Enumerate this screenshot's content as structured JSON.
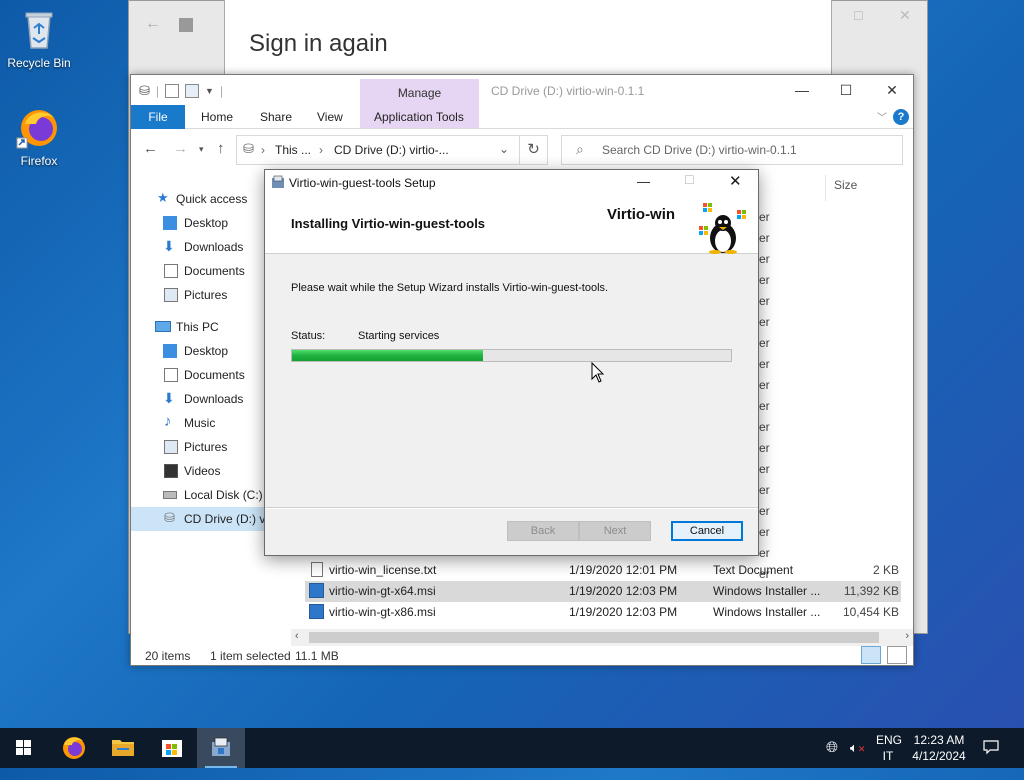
{
  "desktop": {
    "icons": [
      {
        "label": "Recycle Bin"
      },
      {
        "label": "Firefox"
      }
    ]
  },
  "background_window": {
    "title": "Sign in again"
  },
  "explorer": {
    "window_title": "CD Drive (D:) virtio-win-0.1.1",
    "context_tab_group": "Manage",
    "tabs": [
      "File",
      "Home",
      "Share",
      "View",
      "Application Tools"
    ],
    "breadcrumb": [
      "This ...",
      "CD Drive (D:) virtio-..."
    ],
    "search_placeholder": "Search CD Drive (D:) virtio-win-0.1.1",
    "column_size": "Size",
    "nav": {
      "quick_access": "Quick access",
      "quick_items": [
        "Desktop",
        "Downloads",
        "Documents",
        "Pictures"
      ],
      "this_pc": "This PC",
      "pc_items": [
        "Desktop",
        "Documents",
        "Downloads",
        "Music",
        "Pictures",
        "Videos",
        "Local Disk (C:)",
        "CD Drive (D:) vi"
      ]
    },
    "files": [
      {
        "name": "virtio-win_license.txt",
        "date": "1/19/2020 12:01 PM",
        "type": "Text Document",
        "size": "2 KB"
      },
      {
        "name": "virtio-win-gt-x64.msi",
        "date": "1/19/2020 12:03 PM",
        "type": "Windows Installer ...",
        "size": "11,392 KB"
      },
      {
        "name": "virtio-win-gt-x86.msi",
        "date": "1/19/2020 12:03 PM",
        "type": "Windows Installer ...",
        "size": "10,454 KB"
      }
    ],
    "partial_type_fragment": "er",
    "status": {
      "count": "20 items",
      "selected": "1 item selected",
      "size": "11.1 MB"
    }
  },
  "setup": {
    "title": "Virtio-win-guest-tools Setup",
    "heading": "Installing Virtio-win-guest-tools",
    "brand": "Virtio-win",
    "message": "Please wait while the Setup Wizard installs Virtio-win-guest-tools.",
    "status_label": "Status:",
    "status_value": "Starting services",
    "progress": 0.435,
    "buttons": {
      "back": "Back",
      "next": "Next",
      "cancel": "Cancel"
    }
  },
  "taskbar": {
    "lang_top": "ENG",
    "lang_bottom": "IT",
    "time": "12:23 AM",
    "date": "4/12/2024"
  },
  "colors": {
    "accent": "#1979ca",
    "progress": "#21b140",
    "manage_tab": "#e6d5f3"
  }
}
